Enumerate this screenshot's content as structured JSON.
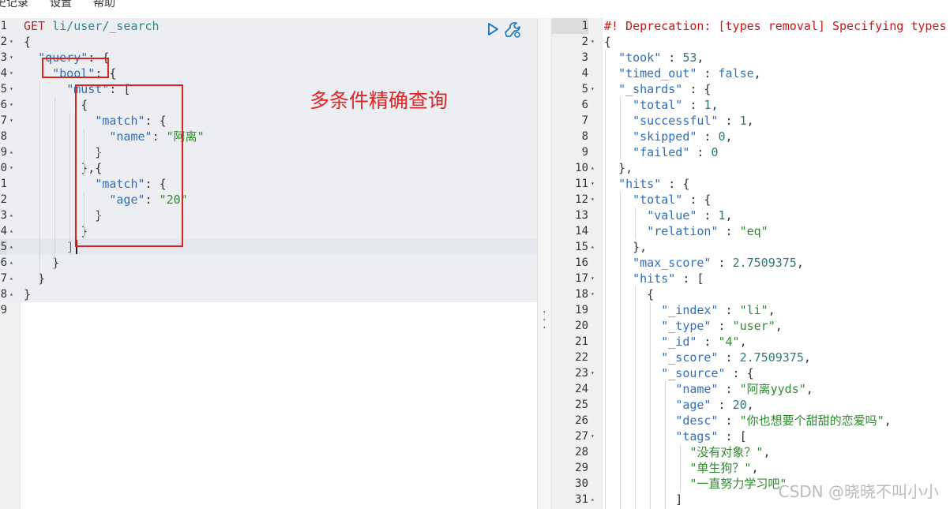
{
  "menu": {
    "items": [
      "史记录",
      "设置",
      "帮助"
    ]
  },
  "request": {
    "method": "GET",
    "path": "li/user/_search",
    "actions": {
      "run_icon": "play-icon",
      "settings_icon": "wrench-icon"
    },
    "lines": [
      {
        "n": "1"
      },
      {
        "n": "2",
        "fold": "▾"
      },
      {
        "n": "3",
        "fold": "▾"
      },
      {
        "n": "4",
        "fold": "▾"
      },
      {
        "n": "5",
        "fold": "▾"
      },
      {
        "n": "6",
        "fold": "▾"
      },
      {
        "n": "7",
        "fold": "▾"
      },
      {
        "n": "8"
      },
      {
        "n": "9",
        "fold": "▴"
      },
      {
        "n": "0",
        "fold": "▾"
      },
      {
        "n": "1"
      },
      {
        "n": "2"
      },
      {
        "n": "3",
        "fold": "▴"
      },
      {
        "n": "4",
        "fold": "▴"
      },
      {
        "n": "5",
        "fold": "▴"
      },
      {
        "n": "6",
        "fold": "▴"
      },
      {
        "n": "7",
        "fold": "▴"
      },
      {
        "n": "8",
        "fold": "▴"
      },
      {
        "n": "9"
      }
    ],
    "code": [
      [
        {
          "c": "m",
          "t": "GET "
        },
        {
          "c": "u",
          "t": "li/user/_search"
        }
      ],
      [
        {
          "t": "{"
        }
      ],
      [
        {
          "t": "  "
        },
        {
          "c": "k",
          "t": "\"query\""
        },
        {
          "t": ": {"
        }
      ],
      [
        {
          "t": "    "
        },
        {
          "c": "k",
          "t": "\"bool\""
        },
        {
          "t": ": {"
        }
      ],
      [
        {
          "t": "      "
        },
        {
          "c": "k",
          "t": "\"must\""
        },
        {
          "t": ": ["
        }
      ],
      [
        {
          "t": "        {"
        }
      ],
      [
        {
          "t": "          "
        },
        {
          "c": "k",
          "t": "\"match\""
        },
        {
          "t": ": {"
        }
      ],
      [
        {
          "t": "            "
        },
        {
          "c": "k",
          "t": "\"name\""
        },
        {
          "t": ": "
        },
        {
          "c": "s",
          "t": "\"阿离\""
        }
      ],
      [
        {
          "t": "          }"
        }
      ],
      [
        {
          "t": "        },{"
        }
      ],
      [
        {
          "t": "          "
        },
        {
          "c": "k",
          "t": "\"match\""
        },
        {
          "t": ": {"
        }
      ],
      [
        {
          "t": "            "
        },
        {
          "c": "k",
          "t": "\"age\""
        },
        {
          "t": ": "
        },
        {
          "c": "s",
          "t": "\"20\""
        }
      ],
      [
        {
          "t": "          }"
        }
      ],
      [
        {
          "t": "        }"
        }
      ],
      [
        {
          "t": "      ]"
        }
      ],
      [
        {
          "t": "    }"
        }
      ],
      [
        {
          "t": "  }"
        }
      ],
      [
        {
          "t": "}"
        }
      ],
      [
        {
          "t": ""
        }
      ]
    ]
  },
  "annotation": {
    "text": "多条件精确查询"
  },
  "response": {
    "lines": [
      {
        "n": "1"
      },
      {
        "n": "2",
        "fold": "▾"
      },
      {
        "n": "3"
      },
      {
        "n": "4"
      },
      {
        "n": "5",
        "fold": "▾"
      },
      {
        "n": "6"
      },
      {
        "n": "7"
      },
      {
        "n": "8"
      },
      {
        "n": "9"
      },
      {
        "n": "10",
        "fold": "▴"
      },
      {
        "n": "11",
        "fold": "▾"
      },
      {
        "n": "12",
        "fold": "▾"
      },
      {
        "n": "13"
      },
      {
        "n": "14"
      },
      {
        "n": "15",
        "fold": "▴"
      },
      {
        "n": "16"
      },
      {
        "n": "17",
        "fold": "▾"
      },
      {
        "n": "18",
        "fold": "▾"
      },
      {
        "n": "19"
      },
      {
        "n": "20"
      },
      {
        "n": "21"
      },
      {
        "n": "22"
      },
      {
        "n": "23",
        "fold": "▾"
      },
      {
        "n": "24"
      },
      {
        "n": "25"
      },
      {
        "n": "26"
      },
      {
        "n": "27",
        "fold": "▾"
      },
      {
        "n": "28"
      },
      {
        "n": "29"
      },
      {
        "n": "30"
      },
      {
        "n": "31",
        "fold": "▴"
      }
    ],
    "code": [
      [
        {
          "c": "w",
          "t": "#! Deprecation: [types removal] Specifying types in search requests is deprecated."
        }
      ],
      [
        {
          "t": "{"
        }
      ],
      [
        {
          "t": "  "
        },
        {
          "c": "k",
          "t": "\"took\""
        },
        {
          "t": " : "
        },
        {
          "c": "n",
          "t": "53"
        },
        {
          "t": ","
        }
      ],
      [
        {
          "t": "  "
        },
        {
          "c": "k",
          "t": "\"timed_out\""
        },
        {
          "t": " : "
        },
        {
          "c": "b",
          "t": "false"
        },
        {
          "t": ","
        }
      ],
      [
        {
          "t": "  "
        },
        {
          "c": "k",
          "t": "\"_shards\""
        },
        {
          "t": " : {"
        }
      ],
      [
        {
          "t": "    "
        },
        {
          "c": "k",
          "t": "\"total\""
        },
        {
          "t": " : "
        },
        {
          "c": "n",
          "t": "1"
        },
        {
          "t": ","
        }
      ],
      [
        {
          "t": "    "
        },
        {
          "c": "k",
          "t": "\"successful\""
        },
        {
          "t": " : "
        },
        {
          "c": "n",
          "t": "1"
        },
        {
          "t": ","
        }
      ],
      [
        {
          "t": "    "
        },
        {
          "c": "k",
          "t": "\"skipped\""
        },
        {
          "t": " : "
        },
        {
          "c": "n",
          "t": "0"
        },
        {
          "t": ","
        }
      ],
      [
        {
          "t": "    "
        },
        {
          "c": "k",
          "t": "\"failed\""
        },
        {
          "t": " : "
        },
        {
          "c": "n",
          "t": "0"
        }
      ],
      [
        {
          "t": "  },"
        }
      ],
      [
        {
          "t": "  "
        },
        {
          "c": "k",
          "t": "\"hits\""
        },
        {
          "t": " : {"
        }
      ],
      [
        {
          "t": "    "
        },
        {
          "c": "k",
          "t": "\"total\""
        },
        {
          "t": " : {"
        }
      ],
      [
        {
          "t": "      "
        },
        {
          "c": "k",
          "t": "\"value\""
        },
        {
          "t": " : "
        },
        {
          "c": "n",
          "t": "1"
        },
        {
          "t": ","
        }
      ],
      [
        {
          "t": "      "
        },
        {
          "c": "k",
          "t": "\"relation\""
        },
        {
          "t": " : "
        },
        {
          "c": "s",
          "t": "\"eq\""
        }
      ],
      [
        {
          "t": "    },"
        }
      ],
      [
        {
          "t": "    "
        },
        {
          "c": "k",
          "t": "\"max_score\""
        },
        {
          "t": " : "
        },
        {
          "c": "n",
          "t": "2.7509375"
        },
        {
          "t": ","
        }
      ],
      [
        {
          "t": "    "
        },
        {
          "c": "k",
          "t": "\"hits\""
        },
        {
          "t": " : ["
        }
      ],
      [
        {
          "t": "      {"
        }
      ],
      [
        {
          "t": "        "
        },
        {
          "c": "k",
          "t": "\"_index\""
        },
        {
          "t": " : "
        },
        {
          "c": "s",
          "t": "\"li\""
        },
        {
          "t": ","
        }
      ],
      [
        {
          "t": "        "
        },
        {
          "c": "k",
          "t": "\"_type\""
        },
        {
          "t": " : "
        },
        {
          "c": "s",
          "t": "\"user\""
        },
        {
          "t": ","
        }
      ],
      [
        {
          "t": "        "
        },
        {
          "c": "k",
          "t": "\"_id\""
        },
        {
          "t": " : "
        },
        {
          "c": "s",
          "t": "\"4\""
        },
        {
          "t": ","
        }
      ],
      [
        {
          "t": "        "
        },
        {
          "c": "k",
          "t": "\"_score\""
        },
        {
          "t": " : "
        },
        {
          "c": "n",
          "t": "2.7509375"
        },
        {
          "t": ","
        }
      ],
      [
        {
          "t": "        "
        },
        {
          "c": "k",
          "t": "\"_source\""
        },
        {
          "t": " : {"
        }
      ],
      [
        {
          "t": "          "
        },
        {
          "c": "k",
          "t": "\"name\""
        },
        {
          "t": " : "
        },
        {
          "c": "s",
          "t": "\"阿离yyds\""
        },
        {
          "t": ","
        }
      ],
      [
        {
          "t": "          "
        },
        {
          "c": "k",
          "t": "\"age\""
        },
        {
          "t": " : "
        },
        {
          "c": "n",
          "t": "20"
        },
        {
          "t": ","
        }
      ],
      [
        {
          "t": "          "
        },
        {
          "c": "k",
          "t": "\"desc\""
        },
        {
          "t": " : "
        },
        {
          "c": "s",
          "t": "\"你也想要个甜甜的恋爱吗\""
        },
        {
          "t": ","
        }
      ],
      [
        {
          "t": "          "
        },
        {
          "c": "k",
          "t": "\"tags\""
        },
        {
          "t": " : ["
        }
      ],
      [
        {
          "t": "            "
        },
        {
          "c": "s",
          "t": "\"没有对象？\""
        },
        {
          "t": ","
        }
      ],
      [
        {
          "t": "            "
        },
        {
          "c": "s",
          "t": "\"单生狗？\""
        },
        {
          "t": ","
        }
      ],
      [
        {
          "t": "            "
        },
        {
          "c": "s",
          "t": "\"一直努力学习吧\""
        }
      ],
      [
        {
          "t": "          ]"
        }
      ]
    ]
  },
  "watermark": "CSDN @晓晓不叫小小"
}
